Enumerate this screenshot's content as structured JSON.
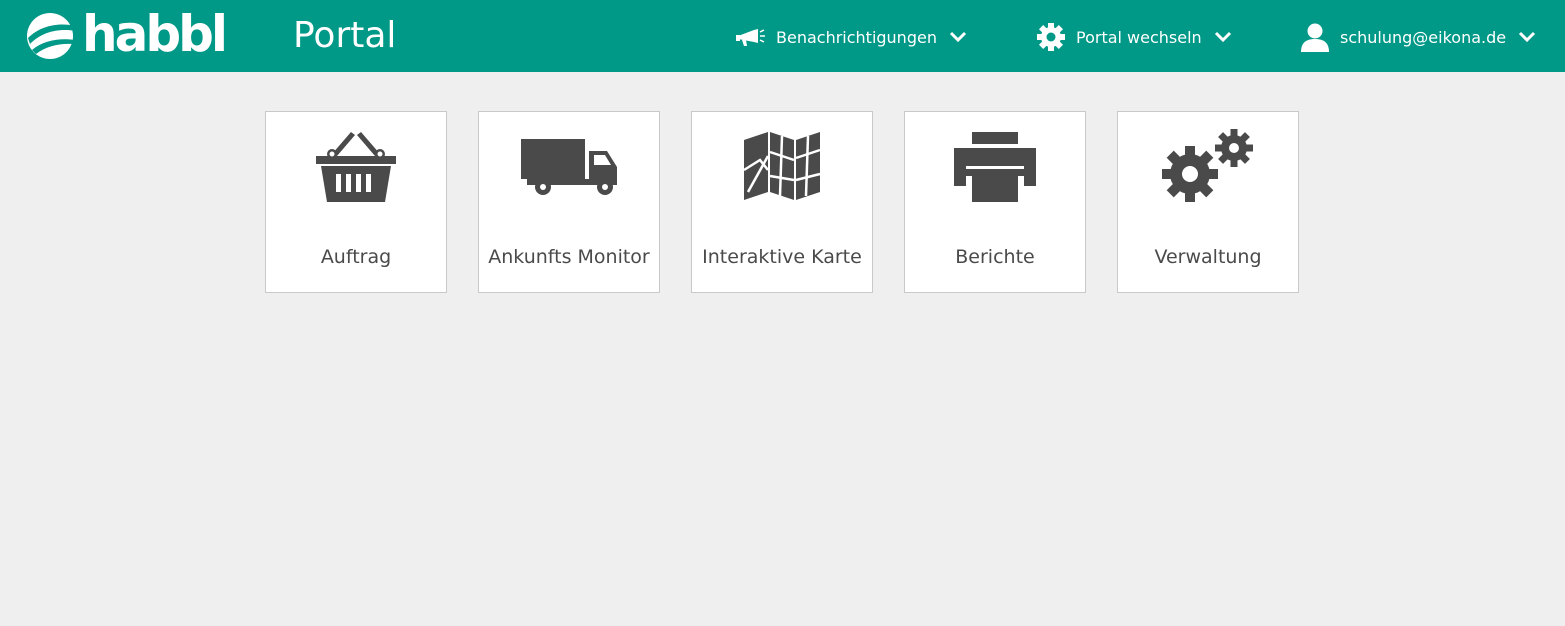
{
  "header": {
    "logo_text": "habbl",
    "title": "Portal",
    "notifications_label": "Benachrichtigungen",
    "switch_portal_label": "Portal wechseln",
    "user_email": "schulung@eikona.de",
    "background_color": "#009887"
  },
  "tiles": [
    {
      "label": "Auftrag",
      "icon": "basket-icon"
    },
    {
      "label": "Ankunfts Monitor",
      "icon": "truck-icon"
    },
    {
      "label": "Interaktive Karte",
      "icon": "map-icon"
    },
    {
      "label": "Berichte",
      "icon": "printer-icon"
    },
    {
      "label": "Verwaltung",
      "icon": "gears-icon"
    }
  ],
  "colors": {
    "icon": "#4a4a4a",
    "page_background": "#efefef",
    "tile_border": "#c9c9c9"
  }
}
